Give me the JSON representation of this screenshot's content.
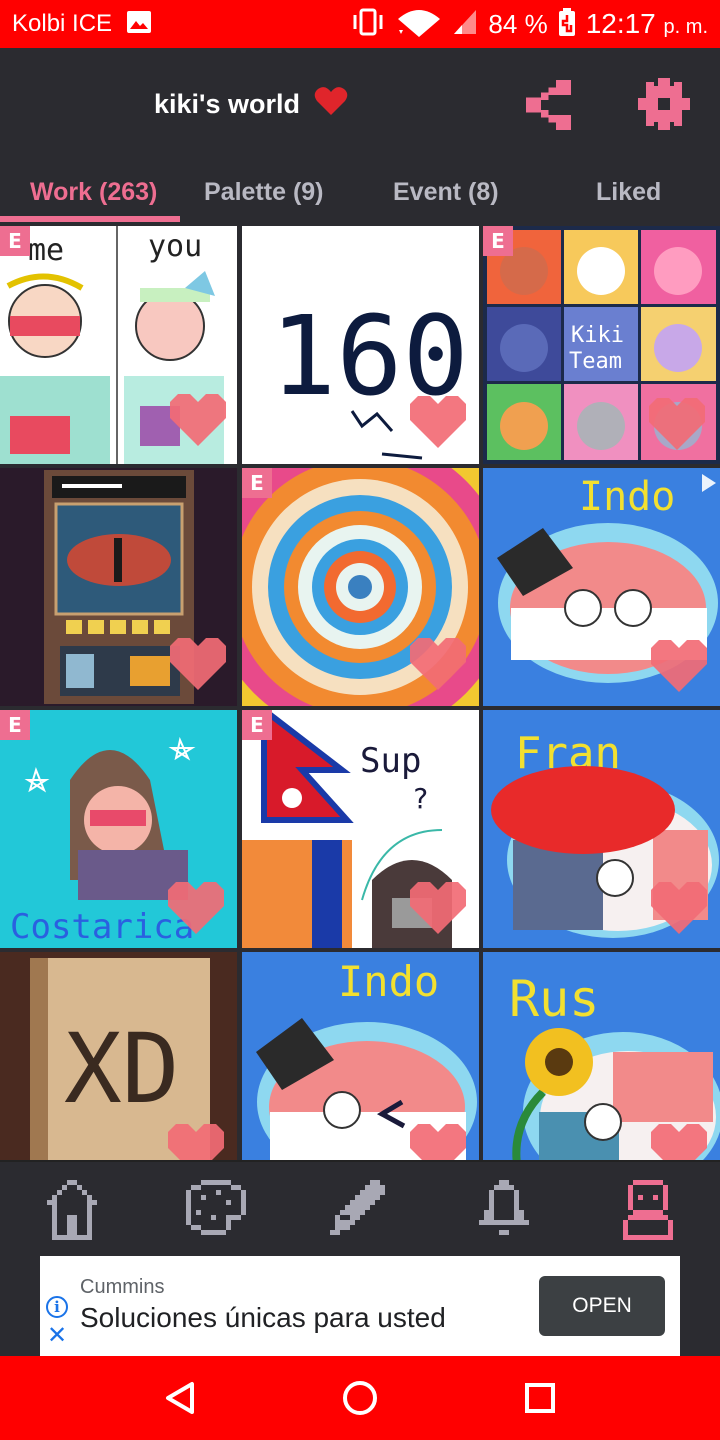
{
  "status_bar": {
    "carrier": "Kolbi ICE",
    "battery_percent": "84 %",
    "time": "12:17",
    "ampm": "p. m.",
    "icons": [
      "image-icon",
      "vibrate-icon",
      "wifi-icon",
      "cellular-signal-icon",
      "battery-charging-icon"
    ]
  },
  "header": {
    "title": "kiki's world",
    "title_icon": "heart-icon",
    "actions": [
      "share-icon",
      "gear-icon"
    ]
  },
  "tabs": [
    {
      "label": "Work",
      "count": "(263)",
      "active": true
    },
    {
      "label": "Palette",
      "count": "(9)",
      "active": false
    },
    {
      "label": "Event",
      "count": "(8)",
      "active": false
    },
    {
      "label": "Liked",
      "count": "",
      "active": false
    }
  ],
  "gallery": {
    "items": [
      {
        "badge": "E",
        "text": [
          "me",
          "you"
        ],
        "liked": true
      },
      {
        "badge": "",
        "text": [
          "160"
        ],
        "liked": true
      },
      {
        "badge": "E",
        "text": [
          "Kiki",
          "Team"
        ],
        "liked": true
      },
      {
        "badge": "",
        "text": [],
        "liked": true
      },
      {
        "badge": "E",
        "text": [],
        "liked": true
      },
      {
        "badge": "",
        "text": [
          "Indo"
        ],
        "liked": true,
        "has_play_marker": true
      },
      {
        "badge": "E",
        "text": [
          "Costarica"
        ],
        "liked": true
      },
      {
        "badge": "E",
        "text": [
          "Sup",
          "?"
        ],
        "liked": true
      },
      {
        "badge": "",
        "text": [
          "Fran"
        ],
        "liked": true
      },
      {
        "badge": "",
        "text": [
          "XD"
        ],
        "liked": true
      },
      {
        "badge": "",
        "text": [
          "Indo"
        ],
        "liked": true
      },
      {
        "badge": "",
        "text": [
          "Rus"
        ],
        "liked": true
      }
    ]
  },
  "bottom_nav": [
    "home-icon",
    "palette-icon",
    "pencil-icon",
    "bell-icon",
    "profile-icon"
  ],
  "ad": {
    "advertiser": "Cummins",
    "headline": "Soluciones únicas para usted",
    "cta": "OPEN"
  },
  "system_nav": [
    "back-icon",
    "home-circle-icon",
    "recents-icon"
  ],
  "colors": {
    "accent": "#ee6e91",
    "background": "#2b2b30",
    "status_bar": "#ff0000",
    "heart": "#f26b75"
  }
}
